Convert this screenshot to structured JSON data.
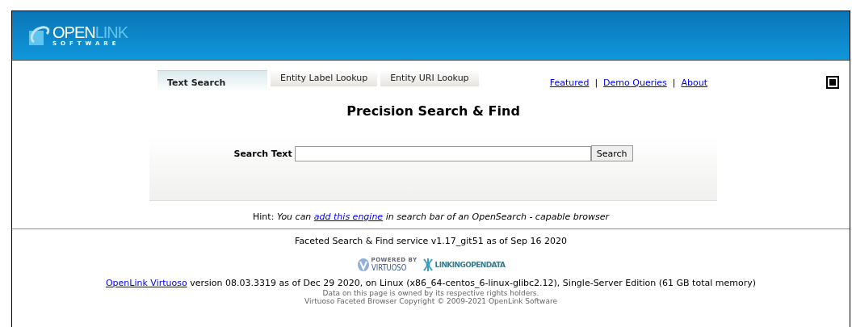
{
  "header": {
    "logo_main": "OPEN",
    "logo_accent": "LINK",
    "logo_sub": "SOFTWARE"
  },
  "tabs": [
    {
      "label": "Text Search",
      "selected": true
    },
    {
      "label": "Entity Label Lookup",
      "selected": false
    },
    {
      "label": "Entity URI Lookup",
      "selected": false
    }
  ],
  "nav_links": [
    "Featured",
    "Demo Queries",
    "About"
  ],
  "nav_separator": "|",
  "panel": {
    "title": "Precision Search & Find",
    "field_label": "Search Text",
    "button": "Search"
  },
  "hint": {
    "label": "Hint:",
    "before": "You can ",
    "link": "add this engine",
    "after": " in search bar of an OpenSearch - capable browser"
  },
  "footer": {
    "service": "Faceted Search & Find service v1.17_git51 as of Sep 16 2020",
    "badges": [
      {
        "kind": "virtuoso",
        "top": "POWERED BY",
        "main": "VIRTUOSO"
      },
      {
        "kind": "lod",
        "main": "LINKINGOPENDATA"
      }
    ],
    "version_link": "OpenLink Virtuoso",
    "version_text": " version 08.03.3319 as of Dec 29 2020, on Linux (x86_64-centos_6-linux-glibc2.12), Single-Server Edition (61 GB total memory)",
    "rights": "Data on this page is owned by its respective rights holders.",
    "copyright": "Virtuoso Faceted Browser Copyright © 2009-2021 OpenLink Software"
  }
}
